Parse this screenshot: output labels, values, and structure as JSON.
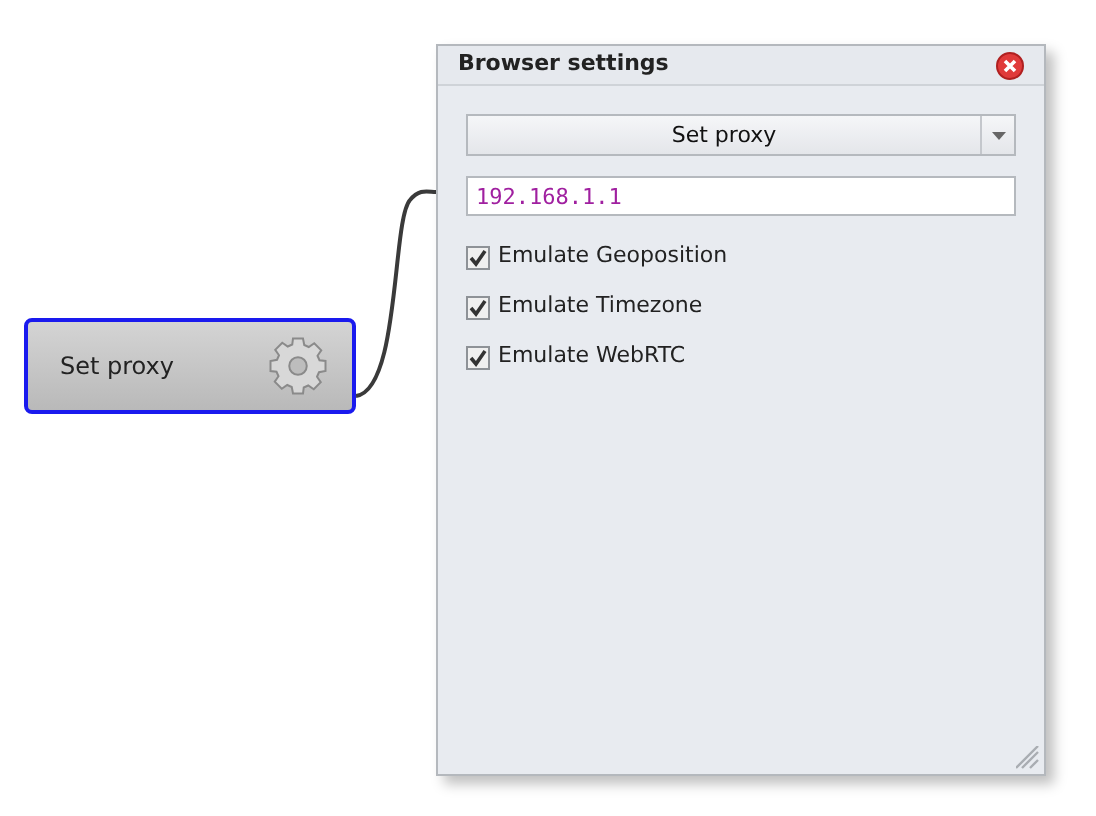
{
  "node": {
    "label": "Set proxy",
    "selected": true
  },
  "panel": {
    "title": "Browser settings",
    "dropdown": {
      "value": "Set proxy"
    },
    "address": {
      "value": "192.168.1.1"
    },
    "options": [
      {
        "label": "Emulate Geoposition",
        "checked": true
      },
      {
        "label": "Emulate Timezone",
        "checked": true
      },
      {
        "label": "Emulate WebRTC",
        "checked": true
      }
    ]
  }
}
